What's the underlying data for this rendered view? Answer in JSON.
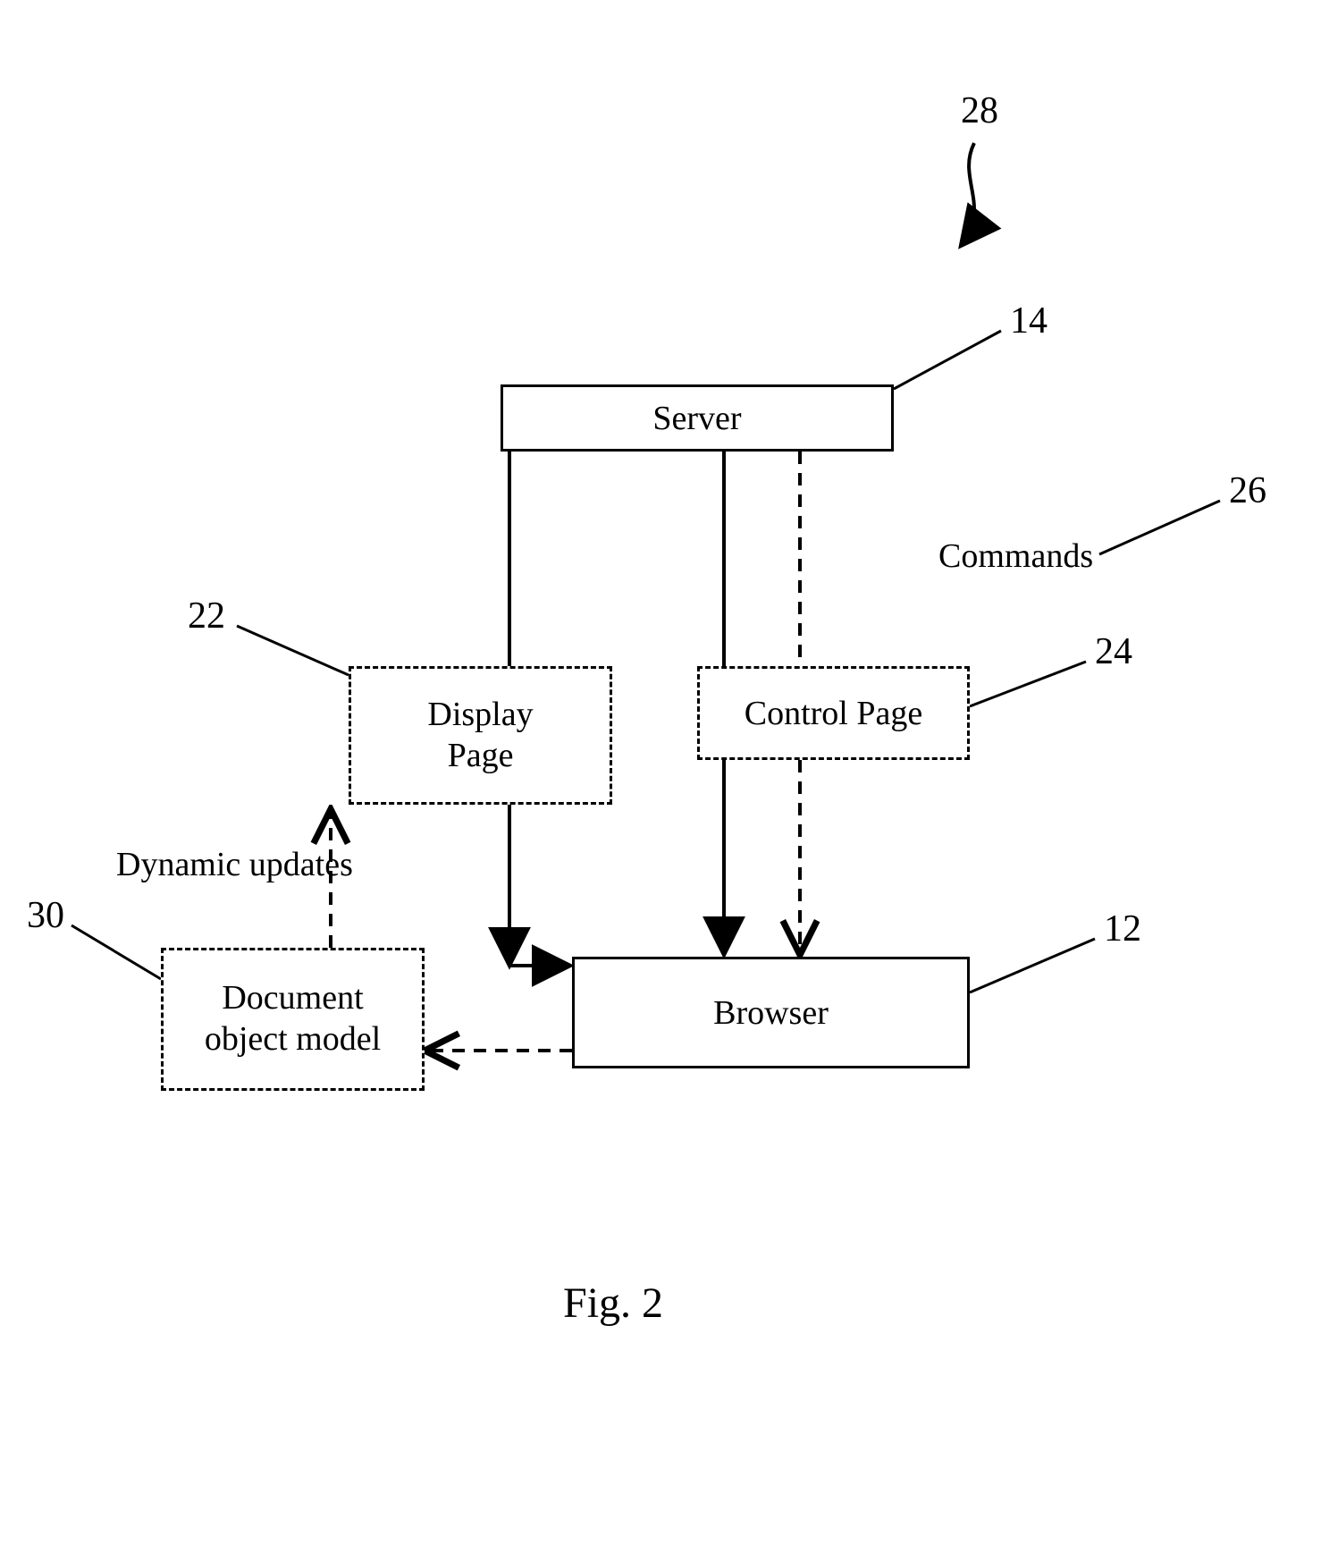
{
  "nodes": {
    "server": {
      "label": "Server",
      "ref": "14"
    },
    "display_page": {
      "label": "Display\nPage",
      "ref": "22"
    },
    "control_page": {
      "label": "Control Page",
      "ref": "24"
    },
    "browser": {
      "label": "Browser",
      "ref": "12"
    },
    "dom": {
      "label": "Document\nobject model",
      "ref": "30"
    }
  },
  "labels": {
    "commands": {
      "text": "Commands",
      "ref": "26"
    },
    "dynamic_updates": "Dynamic updates",
    "system_ref": "28"
  },
  "caption": "Fig. 2"
}
